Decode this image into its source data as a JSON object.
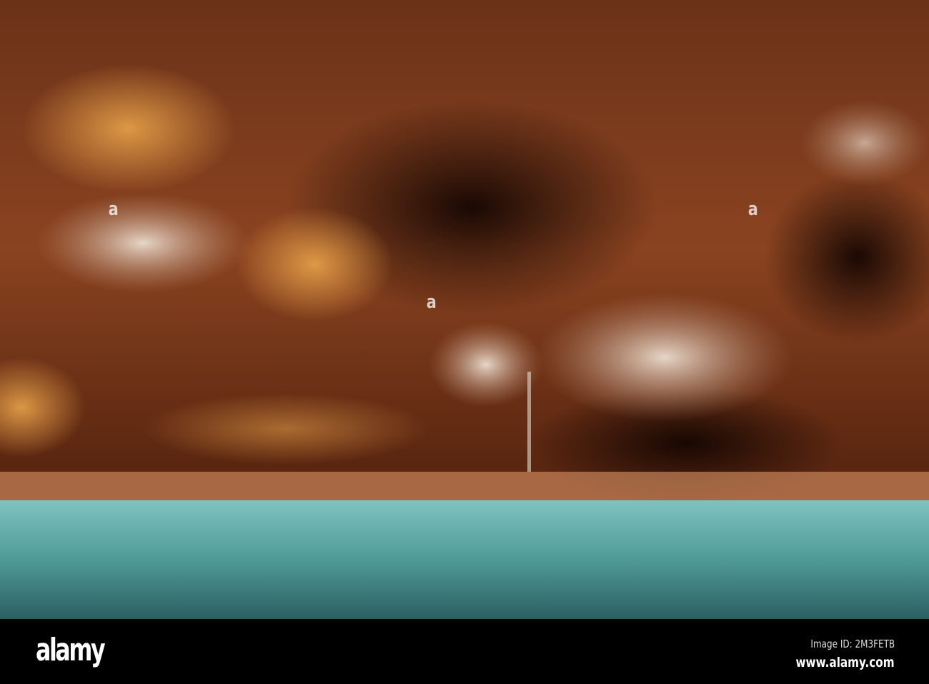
{
  "photo": {
    "subject": "cave-hot-spring-pool",
    "colors": {
      "rock": "#8a4320",
      "rock_highlight": "#d98b3c",
      "mineral": "#d8c4b4",
      "water": "#5fa8a6",
      "shadow": "#1a0804"
    }
  },
  "watermark": {
    "text": "alamy"
  },
  "footer": {
    "logo": "alamy",
    "image_id": "Image ID: 2M3FETB",
    "website": "www.alamy.com"
  }
}
